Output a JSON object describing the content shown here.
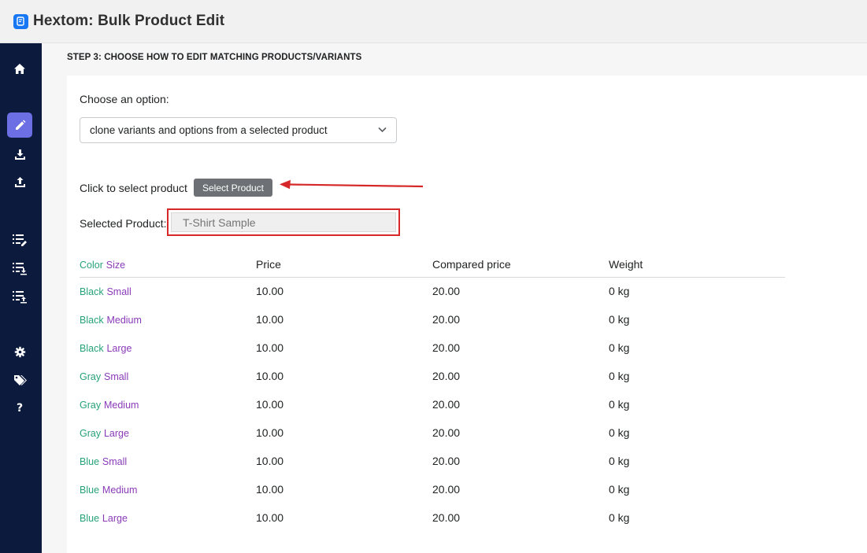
{
  "app": {
    "title": "Hextom: Bulk Product Edit"
  },
  "sidebar": {
    "help_label": "?"
  },
  "step": {
    "title": "STEP 3: CHOOSE HOW TO EDIT MATCHING PRODUCTS/VARIANTS"
  },
  "form": {
    "choose_label": "Choose an option:",
    "option_value": "clone variants and options from a selected product",
    "click_label": "Click to select product",
    "select_button": "Select Product",
    "selected_label": "Selected Product:",
    "selected_placeholder": "T-Shirt Sample"
  },
  "table": {
    "headers": {
      "option1": "Color",
      "option2": "Size",
      "price": "Price",
      "compared": "Compared price",
      "weight": "Weight"
    },
    "rows": [
      {
        "color": "Black",
        "size": "Small",
        "price": "10.00",
        "compared": "20.00",
        "weight": "0 kg"
      },
      {
        "color": "Black",
        "size": "Medium",
        "price": "10.00",
        "compared": "20.00",
        "weight": "0 kg"
      },
      {
        "color": "Black",
        "size": "Large",
        "price": "10.00",
        "compared": "20.00",
        "weight": "0 kg"
      },
      {
        "color": "Gray",
        "size": "Small",
        "price": "10.00",
        "compared": "20.00",
        "weight": "0 kg"
      },
      {
        "color": "Gray",
        "size": "Medium",
        "price": "10.00",
        "compared": "20.00",
        "weight": "0 kg"
      },
      {
        "color": "Gray",
        "size": "Large",
        "price": "10.00",
        "compared": "20.00",
        "weight": "0 kg"
      },
      {
        "color": "Blue",
        "size": "Small",
        "price": "10.00",
        "compared": "20.00",
        "weight": "0 kg"
      },
      {
        "color": "Blue",
        "size": "Medium",
        "price": "10.00",
        "compared": "20.00",
        "weight": "0 kg"
      },
      {
        "color": "Blue",
        "size": "Large",
        "price": "10.00",
        "compared": "20.00",
        "weight": "0 kg"
      }
    ]
  },
  "colors": {
    "sidebar_bg": "#0b1a3d",
    "active_item": "#6c6ee3",
    "option1_text": "#27a27a",
    "option2_text": "#8a3ab9",
    "highlight_red": "#d62828",
    "button_bg": "#6d7175"
  },
  "icons": {
    "sidebar": [
      "home-icon",
      "pencil-icon",
      "download-icon",
      "upload-icon",
      "list-edit-icon",
      "list-download-icon",
      "list-upload-icon",
      "gear-icon",
      "tags-icon",
      "help-icon"
    ],
    "annotation": "red-arrow-icon"
  }
}
